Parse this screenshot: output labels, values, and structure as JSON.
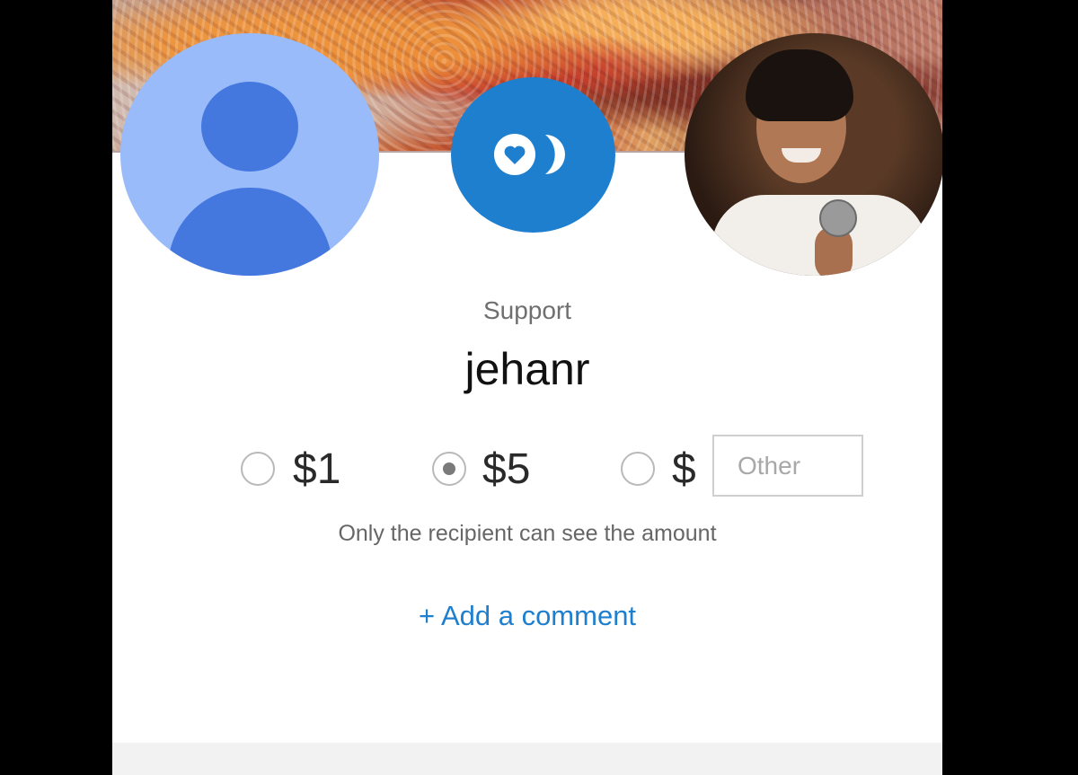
{
  "header": {
    "recipient_label": "Support",
    "username": "jehanr"
  },
  "amounts": {
    "options": [
      {
        "label": "$1",
        "selected": false
      },
      {
        "label": "$5",
        "selected": true
      },
      {
        "label": "$",
        "selected": false
      }
    ],
    "other_placeholder": "Other"
  },
  "privacy_note": "Only the recipient can see the amount",
  "comment_link": "+ Add a comment",
  "colors": {
    "accent": "#1e7fcf",
    "avatar_light": "#99bbf9",
    "avatar_dark": "#4578df"
  },
  "icons": {
    "logo": "heart-coin-logo-icon",
    "sender_avatar": "default-user-avatar",
    "recipient_avatar": "recipient-profile-photo"
  }
}
